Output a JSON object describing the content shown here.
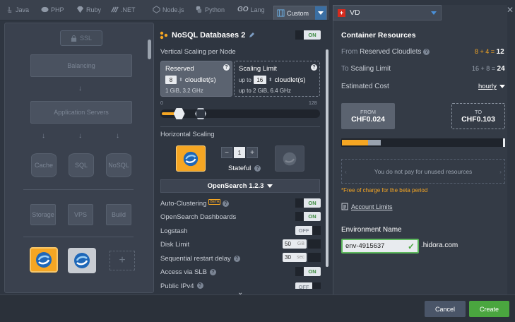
{
  "tabs": [
    {
      "label": "Java",
      "icon": "java-icon"
    },
    {
      "label": "PHP",
      "icon": "php-icon"
    },
    {
      "label": "Ruby",
      "icon": "ruby-icon"
    },
    {
      "label": ".NET",
      "icon": "dotnet-icon"
    },
    {
      "label": "Node.js",
      "icon": "nodejs-icon"
    },
    {
      "label": "Python",
      "icon": "python-icon"
    },
    {
      "label": "Lang",
      "icon": "go-icon",
      "prefix": "GO"
    },
    {
      "label": "Custom",
      "icon": "custom-icon",
      "active": true
    }
  ],
  "topology": {
    "ssl": "SSL",
    "balancing": "Balancing",
    "app_servers": "Application Servers",
    "cache": "Cache",
    "sql": "SQL",
    "nosql": "NoSQL",
    "storage": "Storage",
    "vps": "VPS",
    "build": "Build",
    "add": "+"
  },
  "node": {
    "title": "NoSQL Databases 2",
    "enabled": "ON",
    "vertical_scaling_label": "Vertical Scaling per Node",
    "reserved": {
      "title": "Reserved",
      "count": "8",
      "unit": "cloudlet(s)",
      "spec": "1 GiB, 3.2 GHz"
    },
    "limit": {
      "title": "Scaling Limit",
      "prefix": "up to",
      "count": "16",
      "unit": "cloudlet(s)",
      "spec_prefix": "up to",
      "spec": "2 GiB, 6.4 GHz"
    },
    "slider": {
      "min": "0",
      "max": "128",
      "reserved": 8,
      "limit": 16
    },
    "horizontal_scaling_label": "Horizontal Scaling",
    "node_count": "1",
    "minus": "−",
    "plus": "+",
    "mode": "Stateful",
    "version": "OpenSearch 1.2.3",
    "settings": [
      {
        "label": "Auto-Clustering",
        "badge": "BETA",
        "help": true,
        "state": "ON"
      },
      {
        "label": "OpenSearch Dashboards",
        "help": false,
        "state": "ON"
      },
      {
        "label": "Logstash",
        "help": false,
        "state": "OFF"
      },
      {
        "label": "Disk Limit",
        "help": false,
        "value": "50",
        "unit": "GB"
      },
      {
        "label": "Sequential restart delay",
        "help": true,
        "value": "30",
        "unit": "sec"
      },
      {
        "label": "Access via SLB",
        "help": true,
        "state": "ON"
      },
      {
        "label": "Public IPv4",
        "help": true,
        "state": "OFF"
      }
    ]
  },
  "region": {
    "flag": "+",
    "name": "VD"
  },
  "resources": {
    "title": "Container Resources",
    "from_label_prefix": "From",
    "from_label_main": "Reserved Cloudlets",
    "from_calc": "8 + 4 =",
    "from_total": "12",
    "to_label_prefix": "To",
    "to_label_main": "Scaling Limit",
    "to_calc": "16 + 8 =",
    "to_total": "24",
    "cost_label": "Estimated Cost",
    "period": "hourly",
    "from_caption": "FROM",
    "from_price": "CHF0.024",
    "to_caption": "TO",
    "to_price": "CHF0.103",
    "cost_fill": 0.22,
    "unused_note": "You do not pay for unused resources",
    "beta_note": "*Free of charge for the beta period",
    "account_limits": "Account Limits"
  },
  "environment": {
    "label": "Environment Name",
    "value": "env-4915637",
    "domain": ".hidora.com"
  },
  "footer": {
    "cancel": "Cancel",
    "create": "Create"
  },
  "colors": {
    "accent": "#f5a623",
    "ok": "#5cb85c",
    "create": "#4aa63f",
    "link": "#4b7fc1"
  }
}
